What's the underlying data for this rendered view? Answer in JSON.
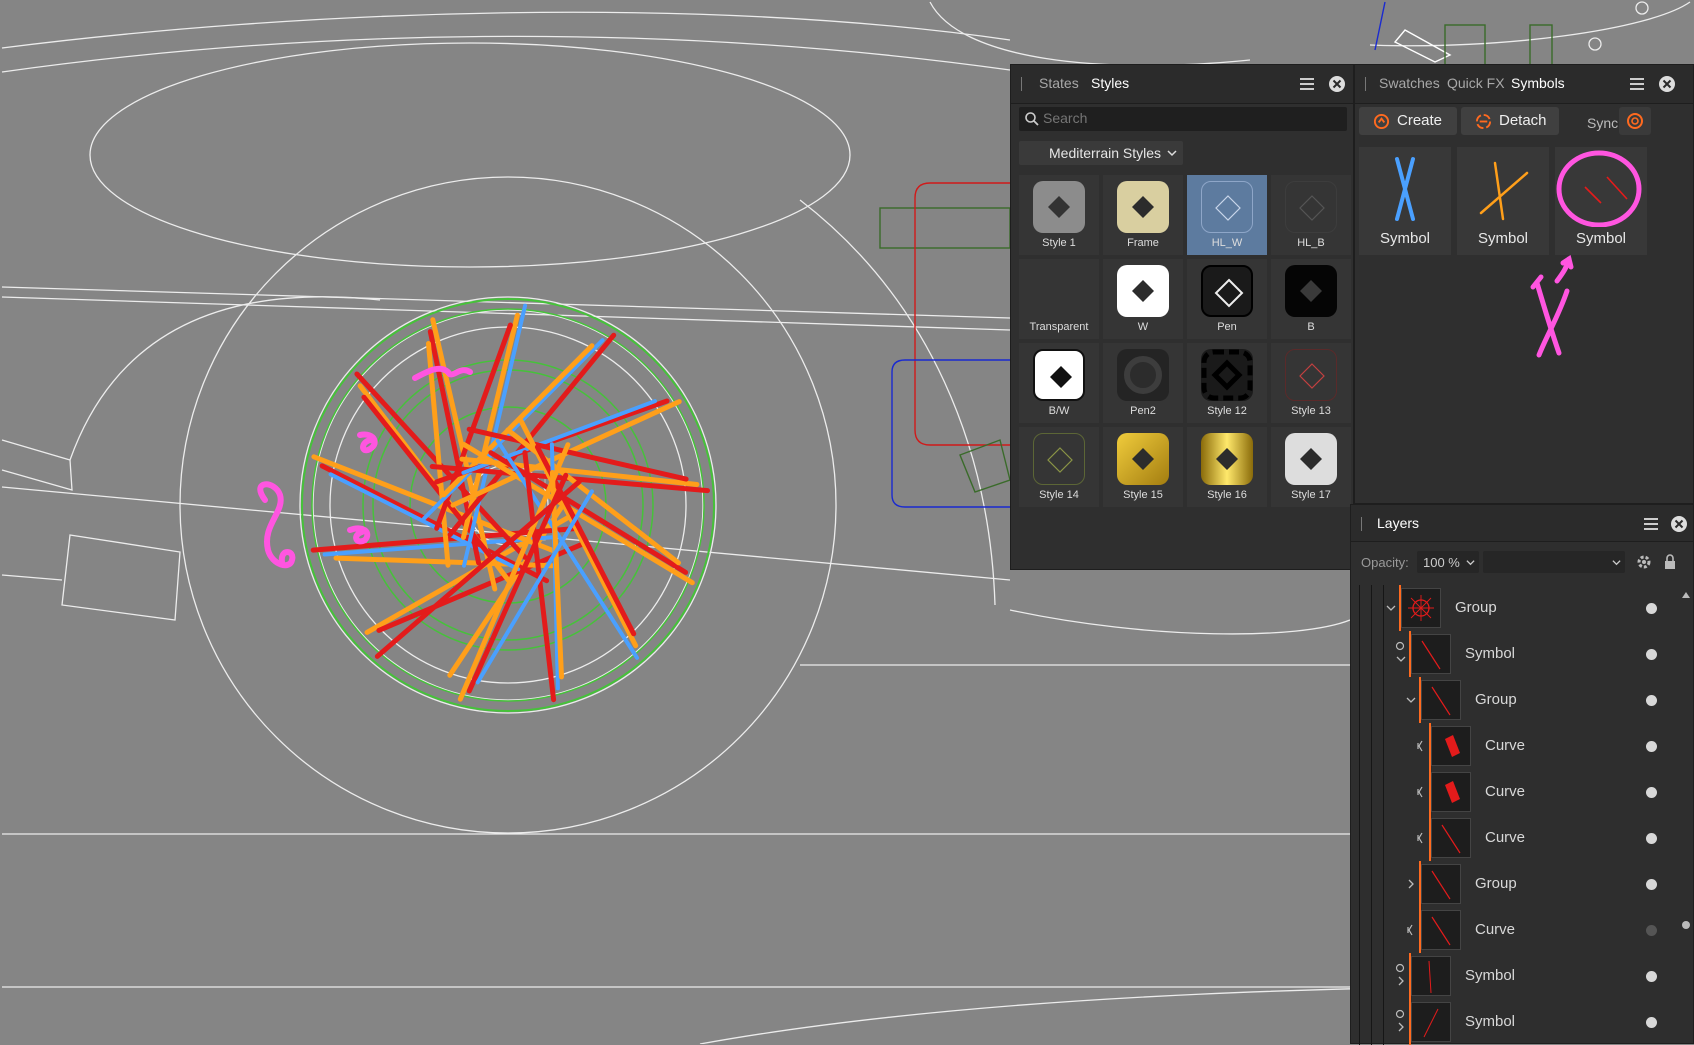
{
  "colors": {
    "canvas": "#858585",
    "accent": "#ff6a1f",
    "select": "#5d7b9f",
    "ink": "#ff55e0"
  },
  "styles_panel": {
    "tabs": [
      "States",
      "Styles"
    ],
    "active_tab": "Styles",
    "search_placeholder": "Search",
    "category": "Mediterrain Styles",
    "styles": [
      {
        "label": "Style 1",
        "kind": "gray"
      },
      {
        "label": "Frame",
        "kind": "cream"
      },
      {
        "label": "HL_W",
        "kind": "outline-light",
        "selected": true
      },
      {
        "label": "HL_B",
        "kind": "outline-dark"
      },
      {
        "label": "Transparent",
        "kind": "empty"
      },
      {
        "label": "W",
        "kind": "white"
      },
      {
        "label": "Pen",
        "kind": "pen"
      },
      {
        "label": "B",
        "kind": "black"
      },
      {
        "label": "B/W",
        "kind": "bw"
      },
      {
        "label": "Pen2",
        "kind": "pen2"
      },
      {
        "label": "Style 12",
        "kind": "dashed"
      },
      {
        "label": "Style 13",
        "kind": "red-outline"
      },
      {
        "label": "Style 14",
        "kind": "olive-outline"
      },
      {
        "label": "Style 15",
        "kind": "gold"
      },
      {
        "label": "Style 16",
        "kind": "gold2"
      },
      {
        "label": "Style 17",
        "kind": "silver"
      }
    ]
  },
  "symbols_panel": {
    "tabs": [
      "Swatches",
      "Quick FX",
      "Symbols"
    ],
    "active_tab": "Symbols",
    "create_label": "Create",
    "detach_label": "Detach",
    "sync_label": "Sync",
    "symbols": [
      {
        "label": "Symbol",
        "icon": "blue-cross-icon"
      },
      {
        "label": "Symbol",
        "icon": "orange-cross-icon"
      },
      {
        "label": "Symbol",
        "icon": "red-strokes-icon"
      }
    ]
  },
  "layers_panel": {
    "title": "Layers",
    "opacity_label": "Opacity:",
    "opacity_value": "100 %",
    "rows": [
      {
        "label": "Group",
        "depth": 0,
        "expander": "open",
        "thumb": "group"
      },
      {
        "label": "Symbol",
        "depth": 1,
        "expander": "open",
        "thumb": "line",
        "symbol": true
      },
      {
        "label": "Group",
        "depth": 2,
        "expander": "open",
        "thumb": "line"
      },
      {
        "label": "Curve",
        "depth": 3,
        "expander": "curve",
        "thumb": "redblock"
      },
      {
        "label": "Curve",
        "depth": 3,
        "expander": "curve",
        "thumb": "redblock"
      },
      {
        "label": "Curve",
        "depth": 3,
        "expander": "curve",
        "thumb": "line"
      },
      {
        "label": "Group",
        "depth": 2,
        "expander": "closed",
        "thumb": "line"
      },
      {
        "label": "Curve",
        "depth": 2,
        "expander": "curve",
        "thumb": "line",
        "dim": true
      },
      {
        "label": "Symbol",
        "depth": 1,
        "expander": "closed",
        "thumb": "line2",
        "symbol": true
      },
      {
        "label": "Symbol",
        "depth": 1,
        "expander": "closed",
        "thumb": "line3",
        "symbol": true
      }
    ]
  }
}
